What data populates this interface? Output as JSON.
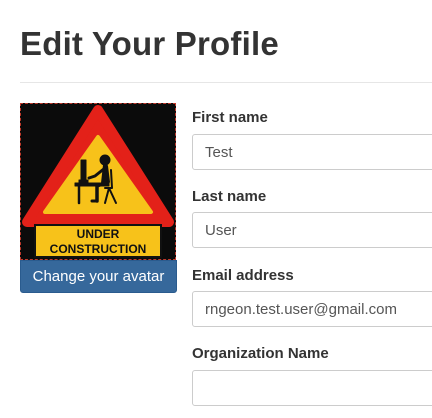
{
  "page": {
    "title": "Edit Your Profile"
  },
  "avatar": {
    "sign_line1": "UNDER",
    "sign_line2": "CONSTRUCTION",
    "change_button_label": "Change your avatar"
  },
  "form": {
    "first_name": {
      "label": "First name",
      "value": "Test"
    },
    "last_name": {
      "label": "Last name",
      "value": "User"
    },
    "email": {
      "label": "Email address",
      "value": "rngeon.test.user@gmail.com"
    },
    "organization": {
      "label": "Organization Name",
      "value": ""
    }
  },
  "colors": {
    "primary_button": "#36689b",
    "sign_red": "#e32119",
    "sign_yellow": "#f7c21a",
    "sign_background": "#0b0b0b"
  }
}
